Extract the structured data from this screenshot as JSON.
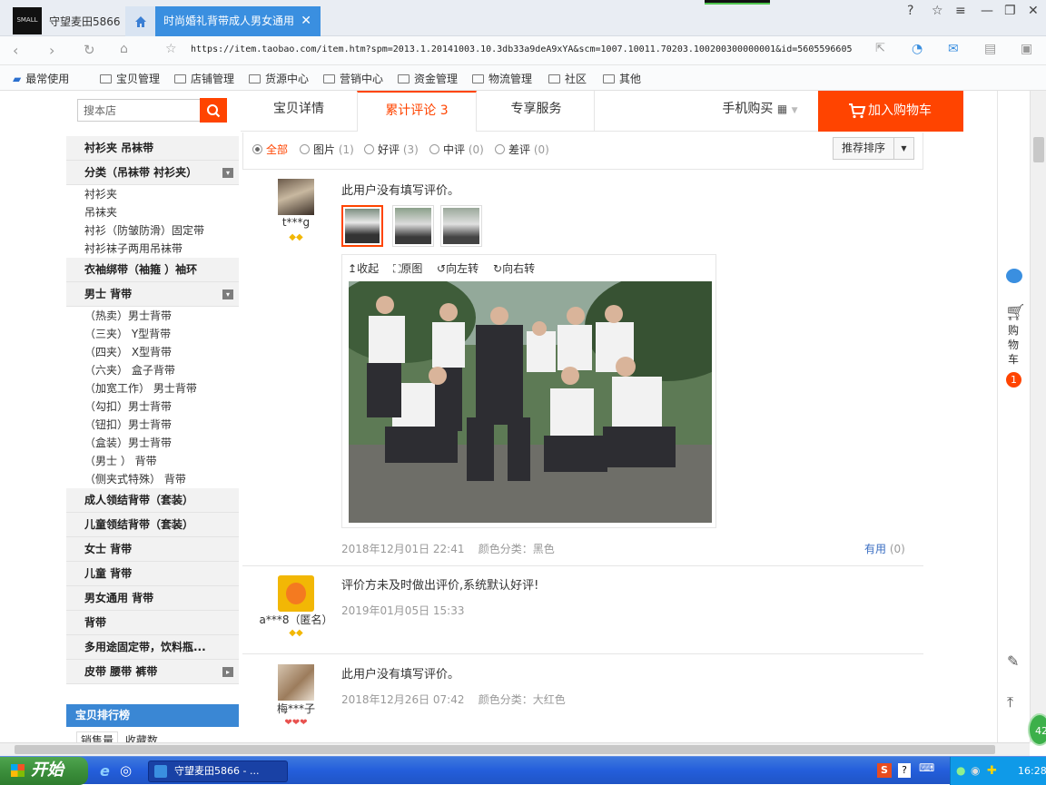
{
  "browser": {
    "tab_shop": "守望麦田5866",
    "tab_active": "时尚婚礼背带成人男女通用",
    "url": "https://item.taobao.com/item.htm?spm=2013.1.20141003.10.3db33a9deA9xYA&scm=1007.10011.70203.100200300000001&id=5605596605",
    "bookmarks": [
      "最常使用",
      "宝贝管理",
      "店铺管理",
      "货源中心",
      "营销中心",
      "资金管理",
      "物流管理",
      "社区",
      "其他"
    ]
  },
  "search": {
    "placeholder": "搜本店"
  },
  "sidebar": {
    "head0": "衬衫夹 吊袜带",
    "head1": "分类（吊袜带 衬衫夹）",
    "items1": [
      "衬衫夹",
      "吊袜夹",
      "衬衫（防皱防滑）固定带",
      "衬衫袜子两用吊袜带"
    ],
    "head2": "衣袖绑带（袖箍 ）袖环",
    "head3": "男士 背带",
    "items3": [
      "（热卖）男士背带",
      "（三夹） Y型背带",
      "（四夹） X型背带",
      "（六夹） 盒子背带",
      "（加宽工作） 男士背带",
      "（勾扣）男士背带",
      "（钮扣）男士背带",
      "（盒装）男士背带",
      "（男士 ） 背带",
      "（侧夹式特殊） 背带"
    ],
    "heads_more": [
      "成人领结背带（套装）",
      "儿童领结背带（套装）",
      "女士 背带",
      "儿童 背带",
      "男女通用 背带",
      "背带",
      "多用途固定带，饮料瓶...",
      "皮带 腰带 裤带"
    ],
    "rank_title": "宝贝排行榜",
    "rank_tabs": [
      "销售量",
      "收藏数"
    ]
  },
  "tabs": {
    "detail": "宝贝详情",
    "reviews": "累计评论",
    "reviews_count": "3",
    "service": "专享服务",
    "mobile": "手机购买",
    "cart": "加入购物车"
  },
  "filters": {
    "all": "全部",
    "pic": "图片",
    "pic_count": "(1)",
    "good": "好评",
    "good_count": "(3)",
    "mid": "中评",
    "mid_count": "(0)",
    "bad": "差评",
    "bad_count": "(0)",
    "sort": "推荐排序"
  },
  "reviews": [
    {
      "user": "t***g",
      "text": "此用户没有填写评价。",
      "date": "2018年12月01日 22:41",
      "spec": "颜色分类：黑色",
      "useful": "有用",
      "useful_count": "(0)"
    },
    {
      "user": "a***8（匿名）",
      "text": "评价方未及时做出评价,系统默认好评!",
      "date": "2019年01月05日 15:33"
    },
    {
      "user": "梅***子",
      "text": "此用户没有填写评价。",
      "date": "2018年12月26日 07:42",
      "spec": "颜色分类：大红色"
    }
  ],
  "photo_tools": {
    "collapse": "收起",
    "original": "原图",
    "rotate_left": "向左转",
    "rotate_right": "向右转"
  },
  "right_panel": {
    "cart_label": "购物车",
    "cart_count": "1"
  },
  "taskbar": {
    "start": "开始",
    "window": "守望麦田5866 - ...",
    "clock": "16:28",
    "bubble": "42"
  }
}
